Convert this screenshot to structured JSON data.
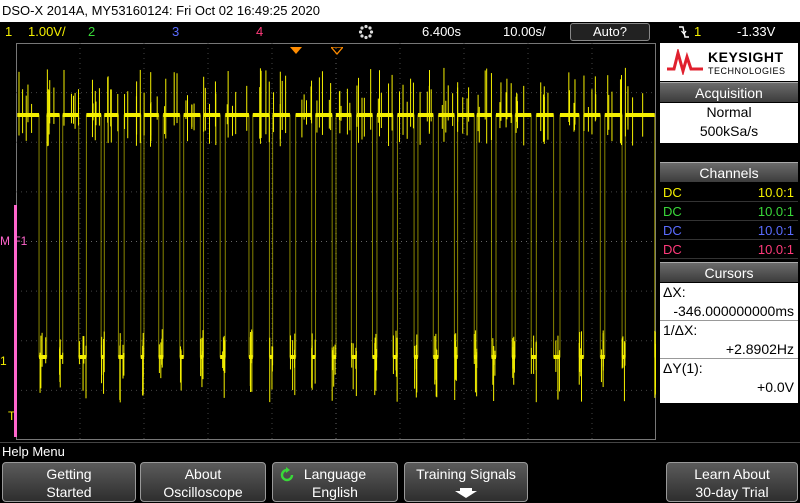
{
  "title_bar": "DSO-X 2014A, MY53160124: Fri Oct 02 16:49:25 2020",
  "status": {
    "ch1_num": "1",
    "ch1_scale": "1.00V/",
    "ch2_num": "2",
    "ch3_num": "3",
    "ch4_num": "4",
    "time_delay": "6.400s",
    "time_scale": "10.00s/",
    "trigger_mode": "Auto?",
    "trigger_icon": "falling-edge-icon",
    "trigger_channel": "1",
    "trigger_level": "-1.33V"
  },
  "markers": {
    "ch1_marker": "1",
    "f1_marker": "M F1",
    "t_marker": "T"
  },
  "side": {
    "brand": "KEYSIGHT",
    "brand_sub": "TECHNOLOGIES",
    "acquisition": {
      "title": "Acquisition",
      "mode": "Normal",
      "rate": "500kSa/s"
    },
    "channels": {
      "title": "Channels",
      "rows": [
        {
          "coupling": "DC",
          "probe": "10.0:1"
        },
        {
          "coupling": "DC",
          "probe": "10.0:1"
        },
        {
          "coupling": "DC",
          "probe": "10.0:1"
        },
        {
          "coupling": "DC",
          "probe": "10.0:1"
        }
      ]
    },
    "cursors": {
      "title": "Cursors",
      "dx_label": "ΔX:",
      "dx_value": "-346.000000000ms",
      "inv_dx_label": "1/ΔX:",
      "inv_dx_value": "+2.8902Hz",
      "dy_label": "ΔY(1):",
      "dy_value": "+0.0V"
    }
  },
  "help_menu": "Help Menu",
  "softkeys": [
    {
      "line1": "Getting",
      "line2": "Started"
    },
    {
      "line1": "About",
      "line2": "Oscilloscope"
    },
    {
      "line1": "Language",
      "line2": "English"
    },
    {
      "line1": "Training Signals",
      "line2": ""
    },
    {
      "line1": "Learn About",
      "line2": "30-day Trial"
    }
  ],
  "colors": {
    "ch1": "#f5f000",
    "ch2": "#39d839",
    "ch3": "#5a6cff",
    "ch4": "#ff3a7a",
    "math": "#ff66cc"
  },
  "waveform": {
    "high_segments": [
      [
        0.2,
        3.6
      ],
      [
        4.8,
        6.8
      ],
      [
        7.3,
        9.8
      ],
      [
        11.0,
        13.3
      ],
      [
        13.8,
        16.0
      ],
      [
        16.9,
        19.5
      ],
      [
        20.0,
        22.3
      ],
      [
        23.0,
        25.6
      ],
      [
        26.2,
        28.8
      ],
      [
        29.3,
        31.9
      ],
      [
        32.7,
        36.4
      ],
      [
        37.0,
        39.6
      ],
      [
        40.1,
        42.8
      ],
      [
        43.7,
        46.2
      ],
      [
        46.8,
        49.4
      ],
      [
        50.0,
        52.4
      ],
      [
        53.2,
        55.7
      ],
      [
        56.4,
        58.9
      ],
      [
        59.6,
        62.2
      ],
      [
        62.8,
        65.2
      ],
      [
        66.0,
        68.5
      ],
      [
        69.0,
        71.6
      ],
      [
        72.0,
        74.3
      ],
      [
        75.0,
        77.5
      ],
      [
        78.0,
        80.5
      ],
      [
        81.3,
        84.0
      ],
      [
        85.0,
        88.0
      ],
      [
        88.7,
        91.3
      ],
      [
        92.0,
        94.7
      ],
      [
        95.2,
        99.8
      ]
    ]
  }
}
